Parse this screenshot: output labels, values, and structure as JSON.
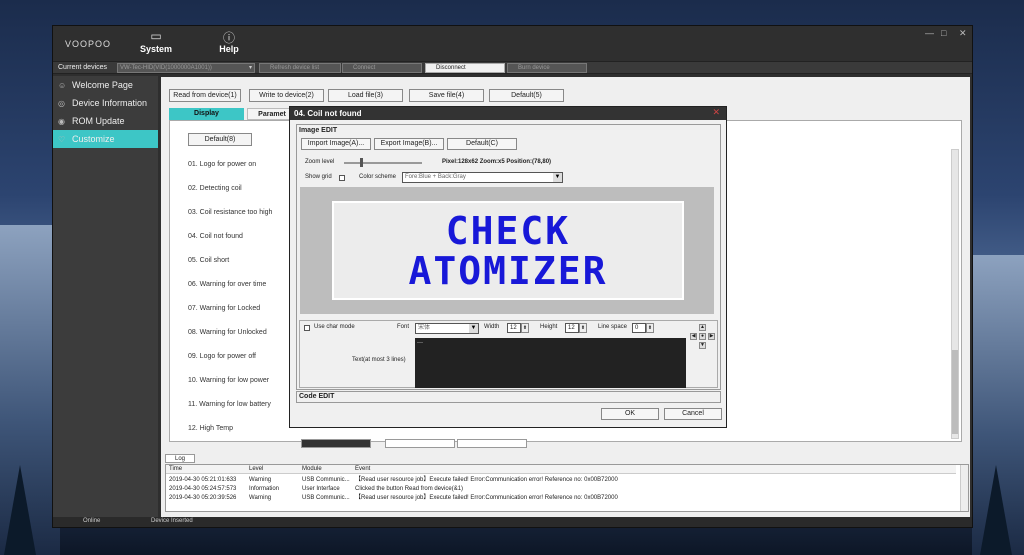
{
  "app": {
    "logo": "VOOPOO"
  },
  "nav": [
    {
      "label": "System",
      "icon": "monitor-icon"
    },
    {
      "label": "Help",
      "icon": "help-icon"
    }
  ],
  "window_controls": [
    "—",
    "□",
    "✕"
  ],
  "devices": {
    "label": "Current devices",
    "selected": "VW-Tec-HID(VID(1000000A1001))",
    "buttons": [
      "Refresh device list",
      "Connect",
      "Disconnect",
      "Burn device"
    ]
  },
  "sidebar": [
    {
      "label": "Welcome Page",
      "icon": "smile-icon"
    },
    {
      "label": "Device Information",
      "icon": "info-icon"
    },
    {
      "label": "ROM Update",
      "icon": "update-icon"
    },
    {
      "label": "Customize",
      "icon": "heart-icon"
    }
  ],
  "toolbar": [
    "Read from device(1)",
    "Write to device(2)",
    "Load file(3)",
    "Save file(4)",
    "Default(5)"
  ],
  "tabs": [
    "Display",
    "Paramet"
  ],
  "panel": {
    "default_button": "Default(8)",
    "items": [
      "01. Logo for power on",
      "02. Detecting coil",
      "03. Coil resistance too high",
      "04. Coil not found",
      "05. Coil short",
      "06. Warning for over time",
      "07. Warning for Locked",
      "08. Warning for Unlocked",
      "09. Logo for power off",
      "10. Warning for low power",
      "11. Warning for low battery",
      "12. High Temp"
    ]
  },
  "dialog": {
    "title": "04. Coil not found",
    "close": "✕",
    "image_edit": "Image EDIT",
    "buttons": [
      "Import Image(A)...",
      "Export Image(B)...",
      "Default(C)"
    ],
    "zoom_label": "Zoom level",
    "pixel_info": "Pixel:128x62  Zoom:x5  Position:(78,80)",
    "show_grid": "Show grid",
    "color_scheme_label": "Color scheme",
    "color_scheme_value": "Fore:Blue + Back:Gray",
    "preview_lines": [
      "CHECK",
      "ATOMIZER"
    ],
    "use_char_mode": "Use char mode",
    "font_label": "Font",
    "font_value": "宋体",
    "width_label": "Width",
    "width_value": "12",
    "height_label": "Height",
    "height_value": "12",
    "line_space_label": "Line space",
    "line_space_value": "0",
    "text_label": "Text(at most 3 lines)",
    "text_value": "---",
    "code_edit": "Code EDIT",
    "ok": "OK",
    "cancel": "Cancel"
  },
  "log": {
    "tab": "Log",
    "headers": [
      "Time",
      "Level",
      "Module",
      "Event"
    ],
    "rows": [
      [
        "2019-04-30 05:21:01:633",
        "Warning",
        "USB Communic...",
        "【Read user resource job】Execute failed! Error:Communication error! Reference no: 0x00B72000"
      ],
      [
        "2019-04-30 05:24:57:573",
        "Information",
        "User Interface",
        "Clicked the button Read from device(&1)"
      ],
      [
        "2019-04-30 05:20:39:526",
        "Warning",
        "USB Communic...",
        "【Read user resource job】Execute failed! Error:Communication error! Reference no: 0x00B72000"
      ]
    ]
  },
  "status": [
    "Online",
    "Device Inserted"
  ],
  "colors": {
    "accent": "#3dc6c6",
    "preview_text": "#1818d8"
  }
}
